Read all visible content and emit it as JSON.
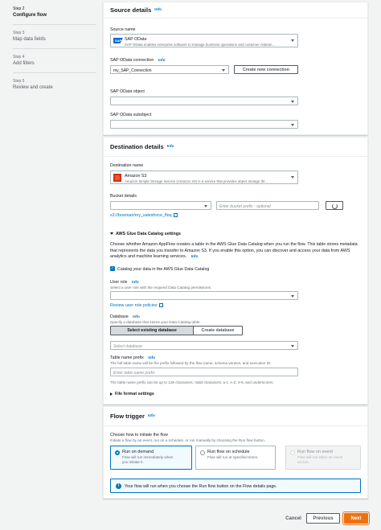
{
  "sidebar": {
    "steps": [
      {
        "num": "Step 2",
        "title": "Configure flow"
      },
      {
        "num": "Step 3",
        "title": "Map data fields"
      },
      {
        "num": "Step 4",
        "title": "Add filters"
      },
      {
        "num": "Step 5",
        "title": "Review and create"
      }
    ]
  },
  "source": {
    "title": "Source details",
    "info": "Info",
    "source_name_label": "Source name",
    "source_name_value": "SAP OData",
    "source_name_desc": "SAP OData enables enterprise software to manage business operations and customer relation...",
    "sap_logo_text": "SAP",
    "connection_label": "SAP OData connection",
    "connection_value": "my_SAP_Connection",
    "create_connection": "Create new connection",
    "object_label": "SAP OData object",
    "subobject_label": "SAP OData subobject"
  },
  "destination": {
    "title": "Destination details",
    "info": "Info",
    "dest_name_label": "Destination name",
    "dest_name_value": "Amazon S3",
    "dest_name_desc": "Amazon Simple Storage Service (Amazon S3) is a service that provides object storage thr...",
    "bucket_label": "Bucket details",
    "bucket_prefix_placeholder": "Enter bucket prefix - optional",
    "bucket_path": "s3://brannair/my_salesforce_floq",
    "glue_title": "AWS Glue Data Catalog settings",
    "glue_desc": "Choose whether Amazon AppFlow creates a table in the AWS Glue Data Catalog when you run the flow. This table stores metadata that represents the data you transfer to Amazon S3. If you enable this option, you can discover and access your data from AWS analytics and machine learning services.",
    "glue_info": "Info",
    "catalog_checkbox": "Catalog your data in the AWS Glue Data Catalog",
    "user_role_label": "User role",
    "user_role_info": "Info",
    "user_role_desc": "Select a user role with the required Data Catalog permissions.",
    "review_roles": "Review user role policies",
    "database_label": "Database",
    "database_info": "Info",
    "database_desc": "Specify a database that stores your Data Catalog table.",
    "select_existing_db": "Select existing database",
    "create_db": "Create database",
    "select_db_placeholder": "Select database",
    "table_prefix_label": "Table name prefix",
    "table_prefix_info": "Info",
    "table_prefix_desc": "The full table name will be the prefix followed by the flow name, schema version, and execution ID.",
    "table_prefix_placeholder": "Enter table name prefix",
    "table_prefix_hint": "The table name prefix can be up to 128 characters. Valid characters: a-z, A-Z, 0-9, and underscores.",
    "file_format": "File format settings"
  },
  "trigger": {
    "title": "Flow trigger",
    "info": "Info",
    "choose_label": "Choose how to initiate the flow",
    "choose_desc": "Initiate a flow by an event, run on a schedule, or run manually by choosing the Run flow button.",
    "options": [
      {
        "title": "Run on demand",
        "desc": "Flow will run immediately when you initiate it."
      },
      {
        "title": "Run flow on schedule",
        "desc": "Flow will run at specified times."
      },
      {
        "title": "Run flow on event",
        "desc": "Flow will run when an event occurs."
      }
    ],
    "info_message": "Your flow will run when you choose the Run flow button on the Flow details page."
  },
  "footer": {
    "cancel": "Cancel",
    "previous": "Previous",
    "next": "Next"
  },
  "colors": {
    "accent": "#0073bb",
    "primary_button": "#ec7211",
    "sap_blue": "#0a6ed1",
    "s3_red": "#d13212"
  }
}
